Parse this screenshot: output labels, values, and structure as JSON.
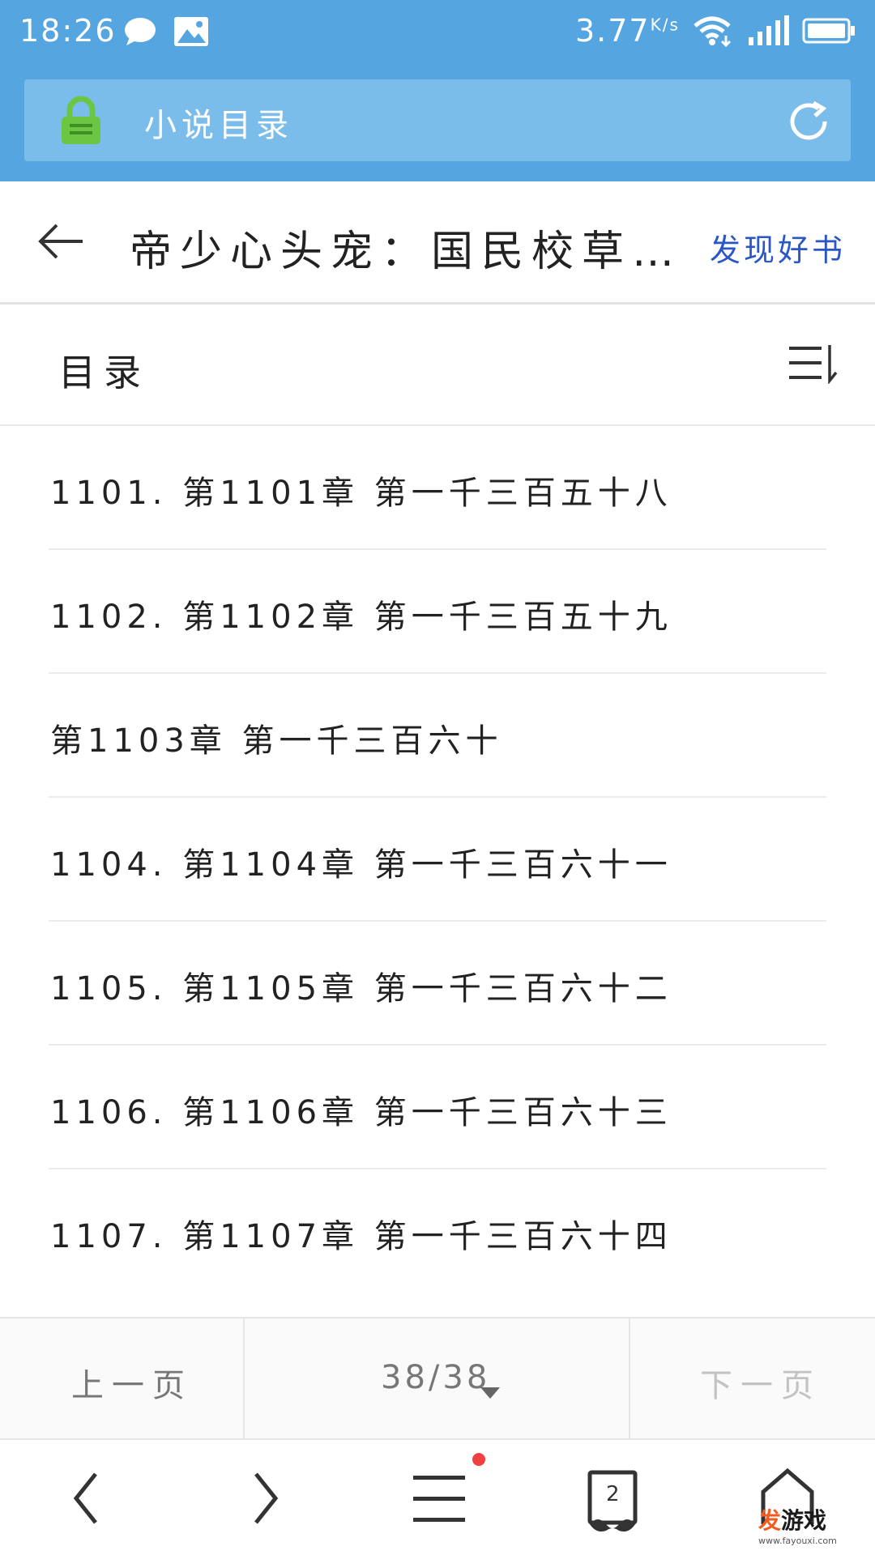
{
  "status_bar": {
    "time": "18:26",
    "speed": "3.77",
    "speed_unit": "K/s"
  },
  "address_bar": {
    "text": "小说目录"
  },
  "header": {
    "title": "帝少心头宠：国民校草…",
    "discover_label": "发现好书"
  },
  "catalog": {
    "label": "目录",
    "chapters": [
      "1101. 第1101章 第一千三百五十八",
      "1102. 第1102章 第一千三百五十九",
      "第1103章 第一千三百六十",
      "1104. 第1104章 第一千三百六十一",
      "1105. 第1105章 第一千三百六十二",
      "1106. 第1106章 第一千三百六十三",
      "1107. 第1107章 第一千三百六十四"
    ]
  },
  "pager": {
    "prev_label": "上一页",
    "page_indicator": "38/38",
    "next_label": "下一页"
  },
  "bottom_nav": {
    "tab_count": "2"
  },
  "watermark": {
    "brand_hi": "发",
    "brand_rest": "游戏",
    "url": "www.fayouxi.com"
  },
  "colors": {
    "top_bar": "#55a6e0",
    "address_bar": "#7abdea",
    "lock_green": "#6cc644",
    "link_blue": "#2a56c6",
    "notification_red": "#f04040"
  },
  "icons": [
    "chat-bubble-icon",
    "image-icon",
    "wifi-icon",
    "signal-icon",
    "battery-icon",
    "lock-icon",
    "refresh-icon",
    "back-arrow-icon",
    "sort-icon",
    "caret-down-icon",
    "nav-back-icon",
    "nav-forward-icon",
    "menu-icon",
    "tabs-icon",
    "home-icon"
  ]
}
